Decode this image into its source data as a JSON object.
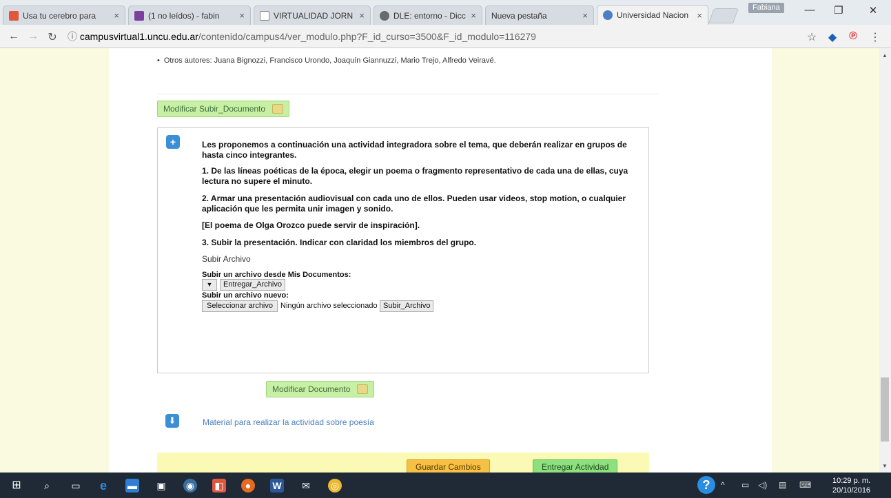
{
  "browser": {
    "tabs": [
      {
        "label": "Usa tu cerebro para",
        "icon": "brain-icon",
        "color": "#e0573e"
      },
      {
        "label": "(1 no leídos) - fabin",
        "icon": "mail-icon",
        "color": "#7b3fa0"
      },
      {
        "label": "VIRTUALIDAD JORN",
        "icon": "document-icon",
        "color": "#888888"
      },
      {
        "label": "DLE: entorno - Dicc",
        "icon": "bell-icon",
        "color": "#6a6a6a"
      },
      {
        "label": "Nueva pestaña",
        "icon": "",
        "color": ""
      },
      {
        "label": "Universidad Nacion",
        "icon": "globe-icon",
        "color": "#4a80c2"
      }
    ],
    "profile": "Fabiana",
    "url_domain": "campusvirtual1.uncu.edu.ar",
    "url_path": "/contenido/campus4/ver_modulo.php?F_id_curso=3500&F_id_modulo=116279"
  },
  "page": {
    "other_authors": "Otros autores: Juana Bignozzi, Francisco Urondo, Joaquín Giannuzzi, Mario Trejo, Alfredo Veiravé.",
    "modify_upload_label": "Modificar Subir_Documento",
    "activity": {
      "intro": "Les proponemos a continuación una actividad integradora sobre el tema, que deberán realizar en grupos de hasta cinco integrantes.",
      "step1": "1. De las líneas poéticas de la época, elegir un poema o fragmento representativo de cada una de ellas, cuya lectura no supere el minuto.",
      "step2": "2. Armar una presentación audiovisual con cada uno de ellos. Pueden usar videos, stop motion, o cualquier aplicación que les permita unir imagen y sonido.",
      "inspiration": "[El poema de Olga Orozco puede servir de inspiración].",
      "step3": "3. Subir la presentación. Indicar con claridad los miembros del grupo.",
      "upload_title": "Subir Archivo",
      "from_docs_label": "Subir un archivo desde Mis Documentos:",
      "deliver_file_button": "Entregar_Archivo",
      "new_file_label": "Subir un archivo nuevo:",
      "choose_file_button": "Seleccionar archivo",
      "no_file_text": "Ningún archivo seleccionado",
      "upload_file_button": "Subir_Archivo"
    },
    "modify_doc_label": "Modificar Documento",
    "material_link": "Material para realizar la actividad sobre poesía",
    "save_button": "Guardar Cambios",
    "deliver_button": "Entregar Actividad"
  },
  "taskbar": {
    "time": "10:29 p. m.",
    "date": "20/10/2016"
  },
  "colors": {
    "accent_blue": "#3b8fd6",
    "green_button": "#c7f0a5",
    "save_orange": "#f6c044",
    "deliver_green": "#8ee07f"
  }
}
